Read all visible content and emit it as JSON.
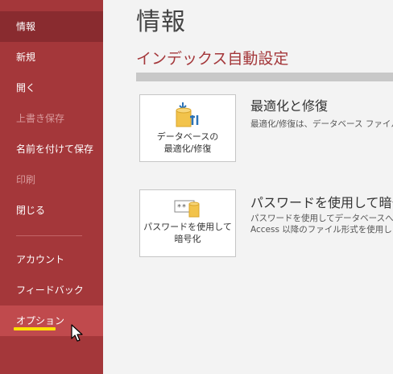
{
  "sidebar": {
    "items": [
      {
        "label": "情報"
      },
      {
        "label": "新規"
      },
      {
        "label": "開く"
      },
      {
        "label": "上書き保存"
      },
      {
        "label": "名前を付けて保存"
      },
      {
        "label": "印刷"
      },
      {
        "label": "閉じる"
      },
      {
        "label": "アカウント"
      },
      {
        "label": "フィードバック"
      },
      {
        "label": "オプション"
      }
    ]
  },
  "main": {
    "title": "情報",
    "section_title": "インデックス自動設定",
    "actions": [
      {
        "button_label": "データベースの\n最適化/修復",
        "title": "最適化と修復",
        "description": "最適化/修復は、データベース ファイル"
      },
      {
        "button_label": "パスワードを使用して\n暗号化",
        "title": "パスワードを使用して暗号",
        "description_line1": "パスワードを使用してデータベースへのア",
        "description_line2": "Access 以降のファイル形式を使用し"
      }
    ]
  },
  "colors": {
    "sidebar": "#a4373a",
    "sidebar_active": "#892b2f",
    "accent_underline": "#ffe100"
  }
}
